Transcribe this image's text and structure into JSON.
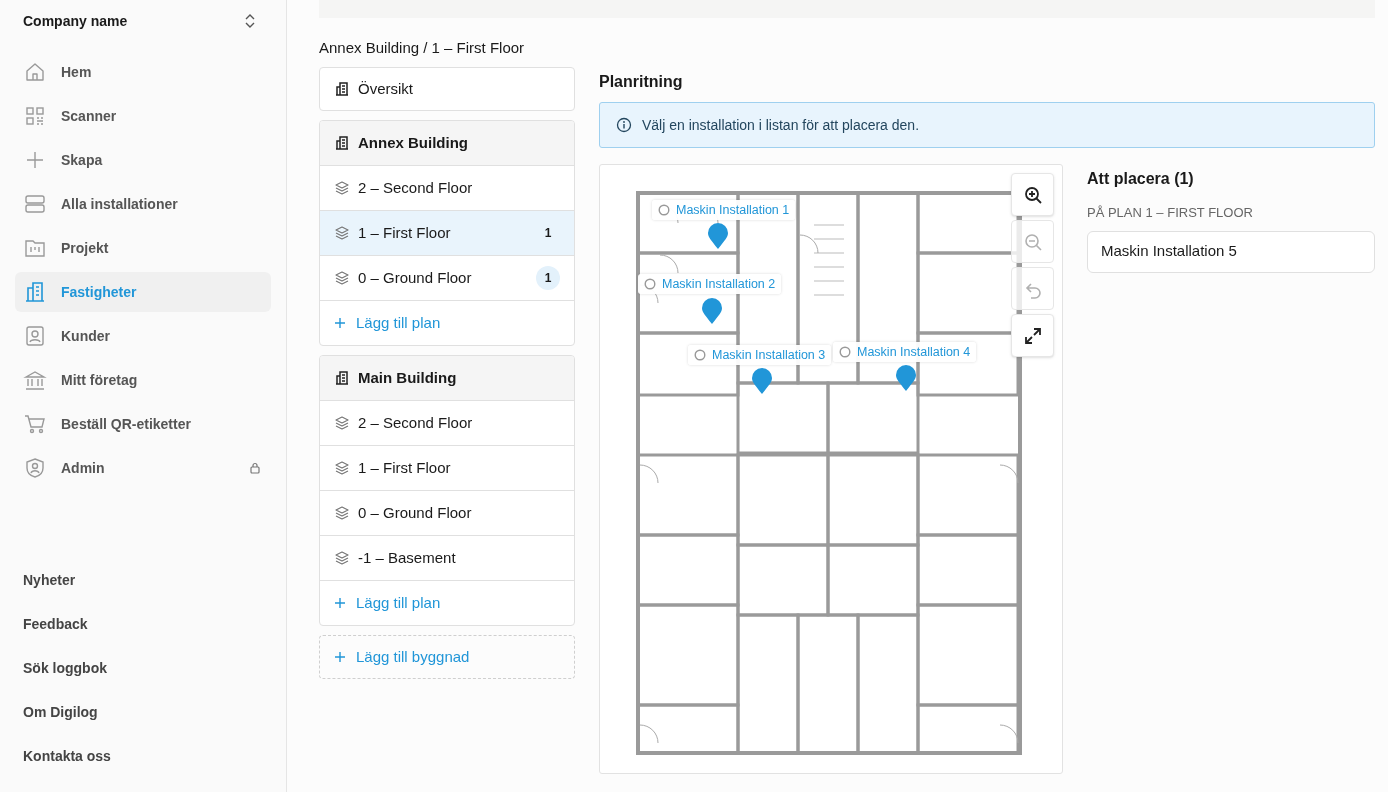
{
  "sidebar": {
    "company": "Company name",
    "nav": [
      {
        "label": "Hem",
        "selected": false,
        "locked": false
      },
      {
        "label": "Scanner",
        "selected": false,
        "locked": false
      },
      {
        "label": "Skapa",
        "selected": false,
        "locked": false
      },
      {
        "label": "Alla installationer",
        "selected": false,
        "locked": false
      },
      {
        "label": "Projekt",
        "selected": false,
        "locked": false
      },
      {
        "label": "Fastigheter",
        "selected": true,
        "locked": false
      },
      {
        "label": "Kunder",
        "selected": false,
        "locked": false
      },
      {
        "label": "Mitt företag",
        "selected": false,
        "locked": false
      },
      {
        "label": "Beställ QR-etiketter",
        "selected": false,
        "locked": false
      },
      {
        "label": "Admin",
        "selected": false,
        "locked": true
      }
    ],
    "footer": [
      "Nyheter",
      "Feedback",
      "Sök loggbok",
      "Om Digilog",
      "Kontakta oss"
    ]
  },
  "breadcrumb": "Annex Building / 1 – First Floor",
  "overview": "Översikt",
  "buildings": [
    {
      "name": "Annex Building",
      "floors": [
        {
          "label": "2 – Second Floor",
          "selected": false
        },
        {
          "label": "1 – First Floor",
          "count": "1",
          "selected": true
        },
        {
          "label": "0 – Ground Floor",
          "count": "1",
          "selected": false
        }
      ],
      "add_label": "Lägg till plan"
    },
    {
      "name": "Main Building",
      "floors": [
        {
          "label": "2 – Second Floor",
          "selected": false
        },
        {
          "label": "1 – First Floor",
          "selected": false
        },
        {
          "label": "0 – Ground Floor",
          "selected": false
        },
        {
          "label": "-1 – Basement",
          "selected": false
        }
      ],
      "add_label": "Lägg till plan"
    }
  ],
  "add_building": "Lägg till byggnad",
  "plan": {
    "title": "Planritning",
    "info": "Välj en installation i listan för att placera den.",
    "markers": [
      {
        "label": "Maskin Installation 1"
      },
      {
        "label": "Maskin Installation 2"
      },
      {
        "label": "Maskin Installation 3"
      },
      {
        "label": "Maskin Installation 4"
      }
    ],
    "controls": [
      {
        "kind": "zoom-in",
        "disabled": false
      },
      {
        "kind": "zoom-out",
        "disabled": true
      },
      {
        "kind": "undo",
        "disabled": true
      },
      {
        "kind": "fullscreen",
        "disabled": false
      }
    ]
  },
  "unplaced": {
    "title": "Att placera (1)",
    "subtitle": "PÅ PLAN 1 – FIRST FLOOR",
    "items": [
      "Maskin Installation 5"
    ]
  }
}
